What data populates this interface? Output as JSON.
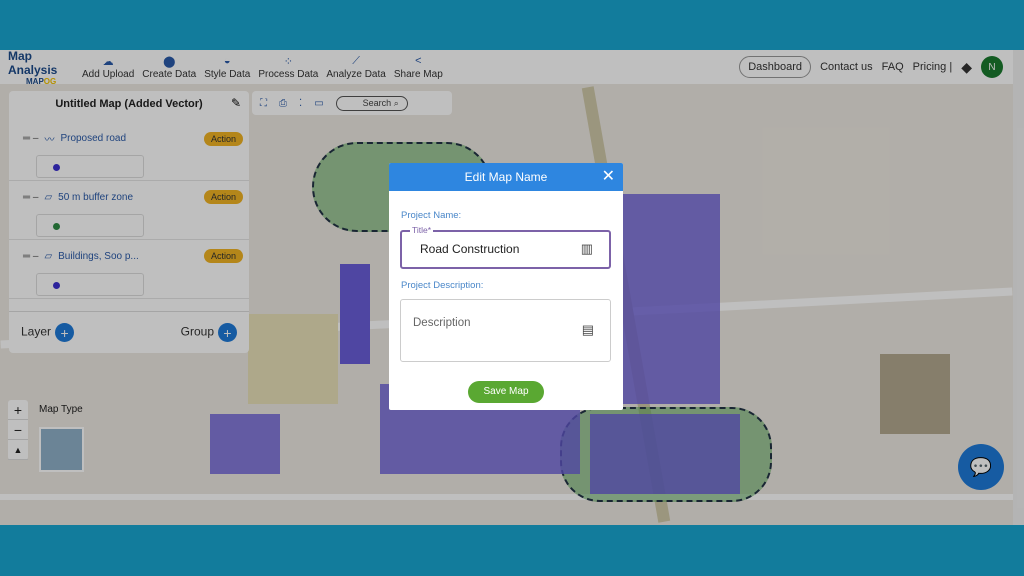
{
  "app": {
    "title": "Map Analysis",
    "logo": "MAPOG"
  },
  "nav": [
    {
      "label": "Add Upload",
      "icon": "cloud-upload-icon"
    },
    {
      "label": "Create Data",
      "icon": "map-pin-icon"
    },
    {
      "label": "Style Data",
      "icon": "paint-bucket-icon"
    },
    {
      "label": "Process Data",
      "icon": "process-icon"
    },
    {
      "label": "Analyze Data",
      "icon": "analyze-icon"
    },
    {
      "label": "Share Map",
      "icon": "share-icon"
    }
  ],
  "header": {
    "dashboard": "Dashboard",
    "contact": "Contact us",
    "faq": "FAQ",
    "pricing": "Pricing |",
    "avatar": "N"
  },
  "panel": {
    "title": "Untitled Map (Added Vector)",
    "layers": [
      {
        "name": "Proposed road",
        "color": "#3b2fd0",
        "action": "Action"
      },
      {
        "name": "50 m buffer zone",
        "color": "#2e8b45",
        "action": "Action"
      },
      {
        "name": "Buildings, Soo p...",
        "color": "#3b2fd0",
        "action": "Action"
      }
    ],
    "layer_label": "Layer",
    "group_label": "Group"
  },
  "toolbar": {
    "search": "Search"
  },
  "map": {
    "map_type": "Map Type"
  },
  "modal": {
    "title": "Edit Map Name",
    "project_name_label": "Project Name:",
    "title_legend": "Title*",
    "title_value": "Road Construction",
    "desc_label": "Project Description:",
    "desc_placeholder": "Description",
    "save": "Save Map"
  }
}
